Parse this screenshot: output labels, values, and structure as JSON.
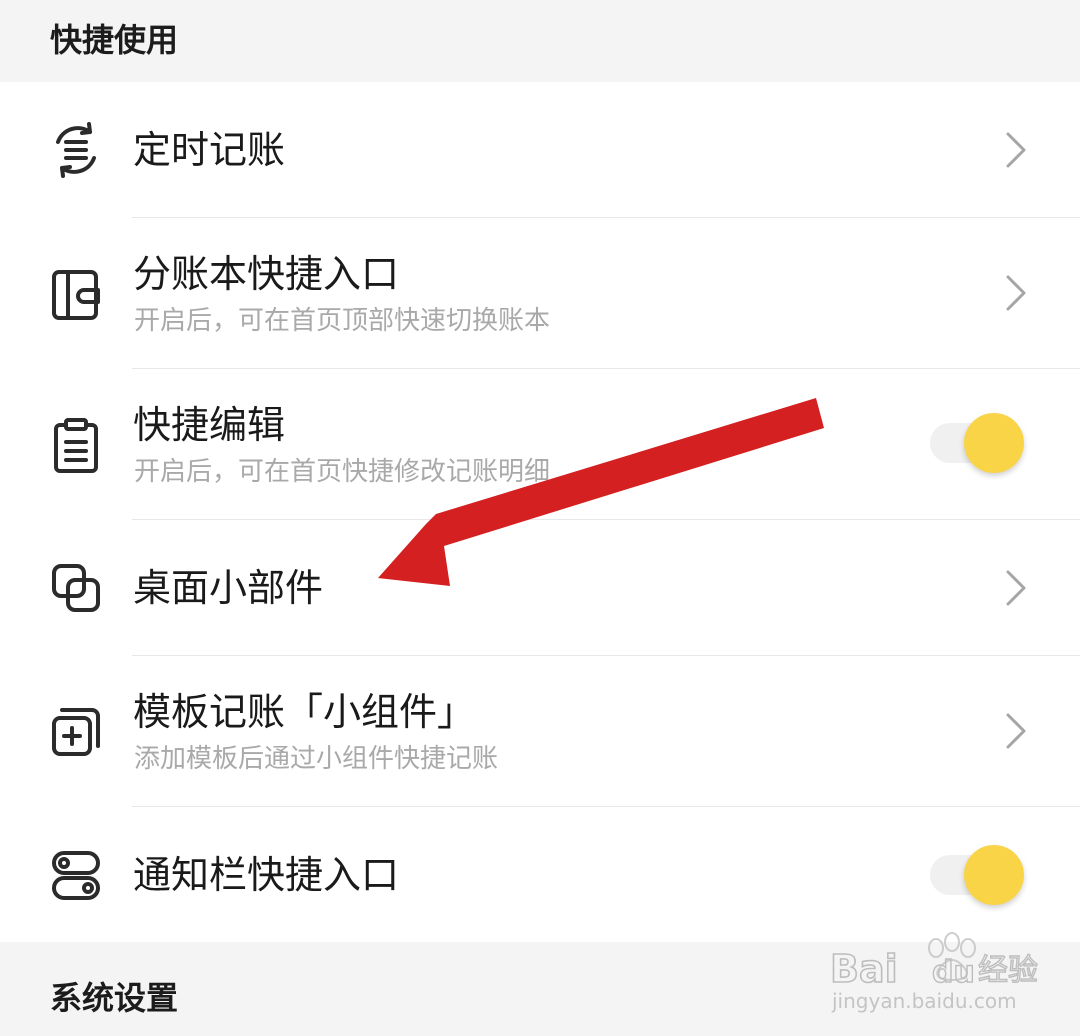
{
  "sections": {
    "quick_use": "快捷使用",
    "system_settings": "系统设置"
  },
  "items": [
    {
      "icon": "scheduled-bookkeeping-icon",
      "title": "定时记账",
      "subtitle": "",
      "control": "chevron"
    },
    {
      "icon": "ledger-shortcut-icon",
      "title": "分账本快捷入口",
      "subtitle": "开启后，可在首页顶部快速切换账本",
      "control": "chevron"
    },
    {
      "icon": "clipboard-icon",
      "title": "快捷编辑",
      "subtitle": "开启后，可在首页快捷修改记账明细",
      "control": "toggle",
      "toggle_on": true
    },
    {
      "icon": "widget-icon",
      "title": "桌面小部件",
      "subtitle": "",
      "control": "chevron"
    },
    {
      "icon": "add-template-icon",
      "title": "模板记账「小组件」",
      "subtitle": "添加模板后通过小组件快捷记账",
      "control": "chevron"
    },
    {
      "icon": "toggle-switch-icon",
      "title": "通知栏快捷入口",
      "subtitle": "",
      "control": "toggle",
      "toggle_on": true
    }
  ],
  "watermark": {
    "brand": "Bai",
    "brand2": "du",
    "product": "经验",
    "url": "jingyan.baidu.com"
  },
  "colors": {
    "toggle_knob": "#f9d447",
    "arrow": "#d42020",
    "subtitle": "#a9a9a9",
    "background": "#f4f4f4"
  }
}
